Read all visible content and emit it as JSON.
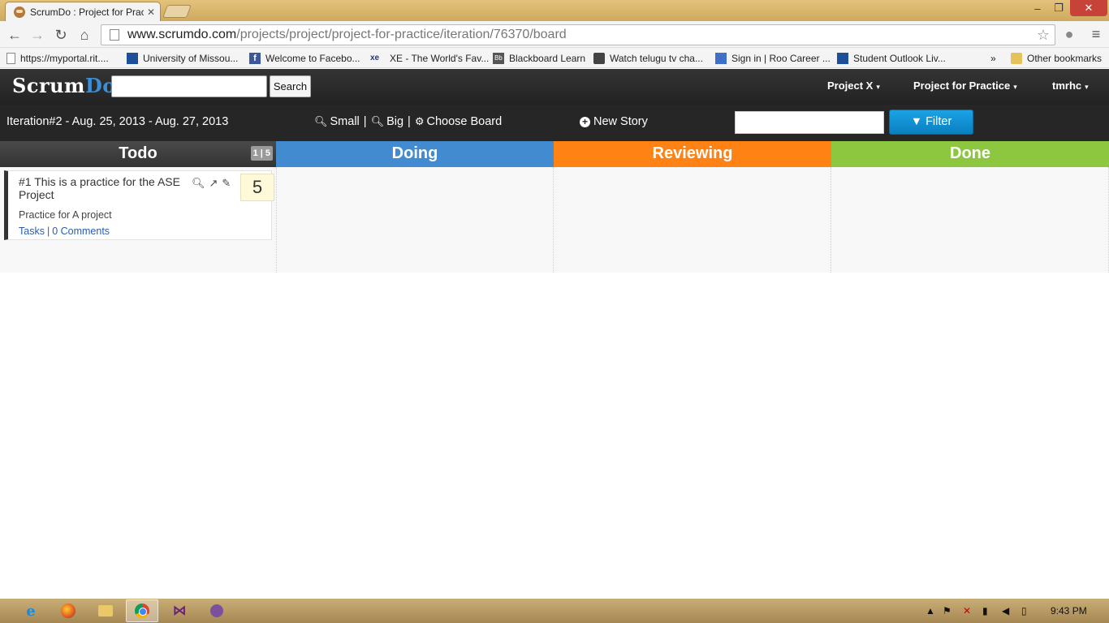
{
  "browser": {
    "tab_title": "ScrumDo : Project for Prac",
    "tab_close": "✕",
    "window_min": "–",
    "window_max": "❐",
    "window_close": "✕",
    "nav": {
      "back": "←",
      "forward": "→",
      "reload": "↻",
      "home": "⌂"
    },
    "url_host": "www.scrumdo.com",
    "url_path": "/projects/project/project-for-practice/iteration/76370/board",
    "star": "☆",
    "menu": "≡",
    "bookmarks": [
      {
        "label": "https://myportal.rit....",
        "icon": "page-icon"
      },
      {
        "label": "University of Missou...",
        "icon": "mizzou-icon"
      },
      {
        "label": "Welcome to Facebo...",
        "icon": "facebook-icon"
      },
      {
        "label": "XE - The World's Fav...",
        "icon": "xe-icon"
      },
      {
        "label": "Blackboard Learn",
        "icon": "blackboard-icon"
      },
      {
        "label": "Watch telugu tv cha...",
        "icon": "tv-icon"
      },
      {
        "label": "Sign in | Roo Career ...",
        "icon": "roo-icon"
      },
      {
        "label": "Student Outlook Liv...",
        "icon": "mizzou-icon"
      }
    ],
    "bookmarks_overflow": "»",
    "other_bookmarks": "Other bookmarks"
  },
  "app": {
    "logo_scrum": "Scrum",
    "logo_do": "Do",
    "search_placeholder": "",
    "search_button": "Search",
    "nav": [
      {
        "label": "Project X"
      },
      {
        "label": "Project for Practice"
      },
      {
        "label": "tmrhc"
      }
    ],
    "caret": "▾"
  },
  "iteration": {
    "title": "Iteration#2 - Aug. 25, 2013 - Aug. 27, 2013",
    "small": "Small",
    "big": "Big",
    "choose_board": "Choose Board",
    "separator": "|",
    "new_story": "New Story",
    "filter_value": "",
    "filter_button": "Filter"
  },
  "board": {
    "columns": [
      {
        "name": "Todo",
        "color": "#3d3d3d",
        "wip": "1 | 5"
      },
      {
        "name": "Doing",
        "color": "#428bd0"
      },
      {
        "name": "Reviewing",
        "color": "#ff8214"
      },
      {
        "name": "Done",
        "color": "#8dc63f"
      }
    ],
    "cards": [
      {
        "title": "#1  This is a practice for the ASE Project",
        "points": "5",
        "description": "Practice for A project",
        "tasks_link": "Tasks",
        "comments_link": "0 Comments",
        "link_separator": "|"
      }
    ]
  },
  "taskbar": {
    "ie": "e",
    "vs": "⋈",
    "clock": "9:43 PM"
  }
}
